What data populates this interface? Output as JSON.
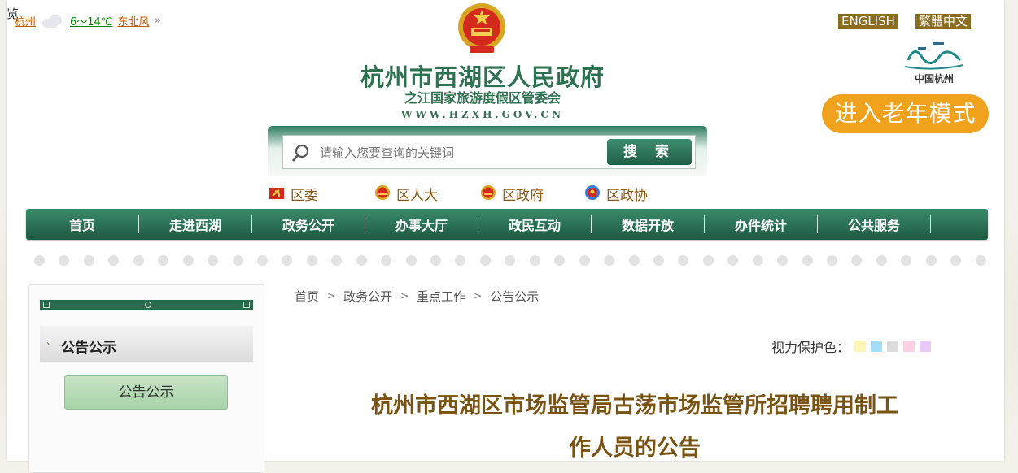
{
  "corner_char": "览",
  "weather": {
    "city": "杭州",
    "temp": "6～14℃",
    "wind": "东北风",
    "more_icon": "double-chevron-right"
  },
  "header": {
    "title": "杭州市西湖区人民政府",
    "subtitle": "之江国家旅游度假区管委会",
    "url": "WWW.HZXH.GOV.CN",
    "lang_en": "ENGLISH",
    "lang_tw": "繁體中文",
    "hz_logo_text": "中国杭州",
    "elder_mode": "进入老年模式"
  },
  "search": {
    "placeholder": "请输入您要查询的关键词",
    "button": "搜 索"
  },
  "quick_links": [
    "区委",
    "区人大",
    "区政府",
    "区政协"
  ],
  "nav": [
    "首页",
    "走进西湖",
    "政务公开",
    "办事大厅",
    "政民互动",
    "数据开放",
    "办件统计",
    "公共服务"
  ],
  "sidebar": {
    "heading": "公告公示",
    "button": "公告公示"
  },
  "breadcrumb": [
    "首页",
    "政务公开",
    "重点工作",
    "公告公示"
  ],
  "eye_protect": {
    "label": "视力保护色：",
    "colors": [
      "#fcf5b5",
      "#a7dcf6",
      "#dcdcdc",
      "#fcd0e4",
      "#e8c8f8"
    ]
  },
  "article": {
    "title_line1": "杭州市西湖区市场监管局古荡市场监管所招聘聘用制工",
    "title_line2": "作人员的公告"
  },
  "colors": {
    "brand_green": "#2e7150",
    "gold": "#8a6d1f",
    "elder_orange": "#f0a21c",
    "title_brown": "#7a5311"
  }
}
